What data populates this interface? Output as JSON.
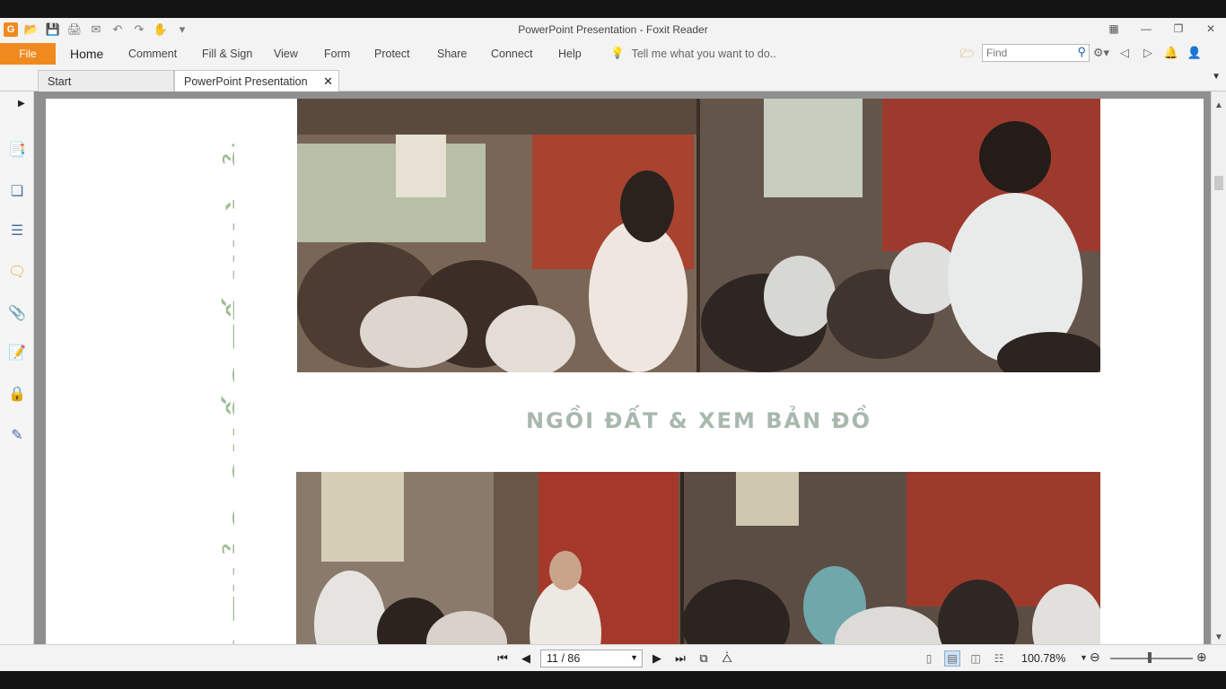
{
  "window": {
    "title": "PowerPoint Presentation - Foxit Reader"
  },
  "quick_access": {
    "icons": [
      "app-logo",
      "open-icon",
      "save-icon",
      "print-icon",
      "email-icon",
      "undo-icon",
      "redo-icon",
      "hand-tool-icon",
      "customize-icon"
    ],
    "app_logo_letter": "G"
  },
  "menu": {
    "file": "File",
    "items": [
      "Home",
      "Comment",
      "Fill & Sign",
      "View",
      "Form",
      "Protect",
      "Share",
      "Connect",
      "Help"
    ],
    "tell_me": "Tell me what you want to do..",
    "find_placeholder": "Find"
  },
  "tabs": [
    {
      "label": "Start"
    },
    {
      "label": "PowerPoint Presentation"
    }
  ],
  "document": {
    "vertical_title": "I THẢO QUỐC TẾ NHÀ Ở",
    "caption": "NGỒI ĐẤT  &  XEM BẢN ĐỒ"
  },
  "status": {
    "page_indicator": "11 / 86",
    "zoom": "100.78%"
  },
  "colors": {
    "accent": "#f08a1e",
    "title_green": "#9fbc97",
    "caption_gray": "#a9b8ad"
  }
}
